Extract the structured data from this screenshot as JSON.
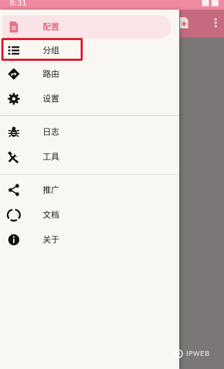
{
  "status_bar": {
    "time": "8:31"
  },
  "toolbar": {
    "add_icon": "add-file-icon",
    "more_icon": "more-vert-icon"
  },
  "drawer": {
    "accent_color": "#d33a5c",
    "highlight_color": "#e3172a",
    "groups": [
      [
        {
          "label": "配置",
          "icon": "document-icon",
          "active": true
        },
        {
          "label": "分组",
          "icon": "list-icon",
          "highlighted": true
        },
        {
          "label": "路由",
          "icon": "route-icon"
        },
        {
          "label": "设置",
          "icon": "gear-icon"
        }
      ],
      [
        {
          "label": "日志",
          "icon": "bug-icon"
        },
        {
          "label": "工具",
          "icon": "tools-icon"
        }
      ],
      [
        {
          "label": "推广",
          "icon": "share-icon"
        },
        {
          "label": "文档",
          "icon": "docs-ring-icon"
        },
        {
          "label": "关于",
          "icon": "info-icon"
        }
      ]
    ]
  },
  "watermark": {
    "text": "IPWEB"
  }
}
